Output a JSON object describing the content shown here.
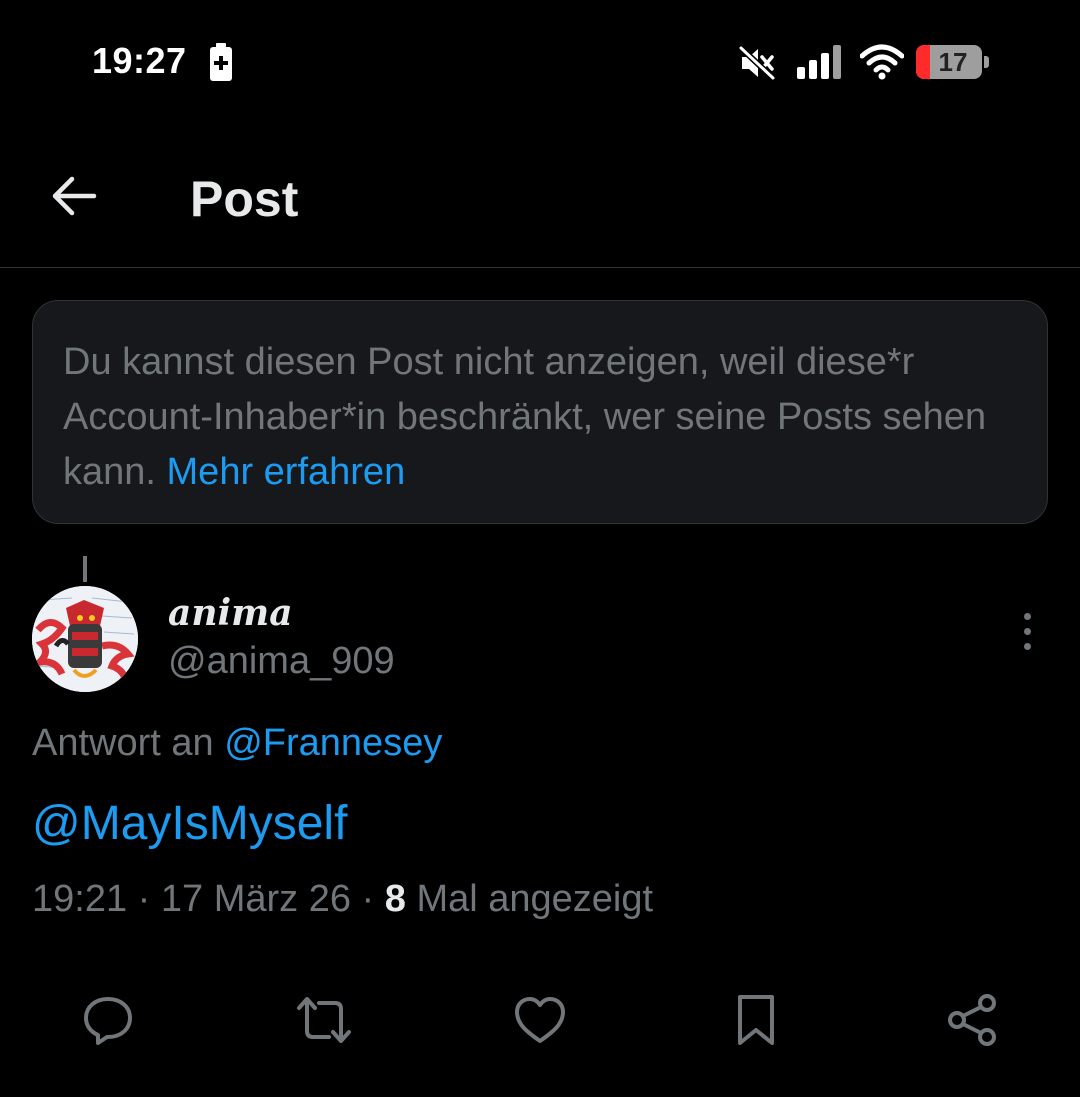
{
  "status_bar": {
    "time": "19:27",
    "battery_level": "17",
    "icons": [
      "battery-charging-icon",
      "mute-icon",
      "signal-icon",
      "wifi-icon",
      "battery-icon"
    ]
  },
  "header": {
    "title": "Post",
    "back_icon": "arrow-left-icon"
  },
  "notice": {
    "text": "Du kannst diesen Post nicht anzeigen, weil diese*r Account-Inhaber*in beschränkt, wer seine Posts sehen kann.",
    "link": "Mehr erfahren"
  },
  "post": {
    "display_name": "anima",
    "handle": "@anima_909",
    "reply_prefix": "Antwort an",
    "reply_to": "@Frannesey",
    "text": "@MayIsMyself",
    "time": "19:21",
    "date": "17 März 26",
    "views_count": "8",
    "views_label": "Mal angezeigt",
    "separator": "·"
  },
  "actions": [
    "reply-icon",
    "repost-icon",
    "like-icon",
    "bookmark-icon",
    "share-icon"
  ],
  "colors": {
    "background": "#000000",
    "accent": "#1d9bf0",
    "muted": "#71767b",
    "text": "#e7e9ea",
    "notice_bg": "#16181c",
    "battery_low": "#ff2a2a"
  }
}
